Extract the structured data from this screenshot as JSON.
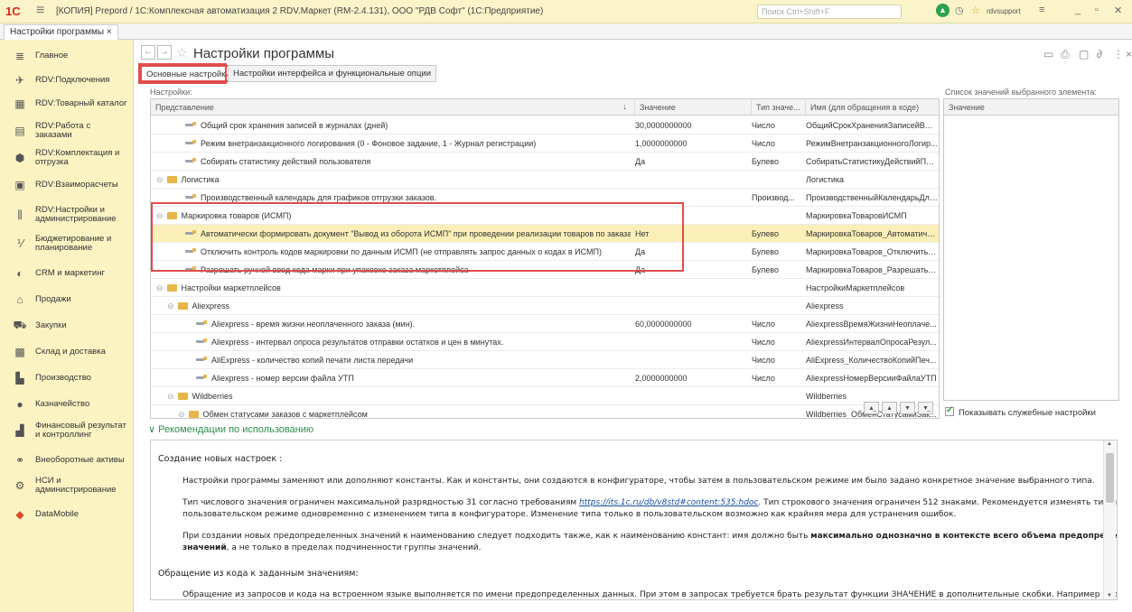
{
  "titlebar": {
    "logo": "1С",
    "title": "[КОПИЯ] Prepord / 1С:Комплексная автоматизация 2 RDV.Маркет (RM-2.4.131), ООО \"РДВ Софт\" (1С:Предприятие)",
    "search_placeholder": "Поиск Ctrl+Shift+F",
    "user": "rdvsupport"
  },
  "tab": {
    "label": "Настройки программы ×"
  },
  "sidebar": {
    "items": [
      {
        "label": "Главное",
        "icon": "menu-icon"
      },
      {
        "label": "RDV:Подключения",
        "icon": "rocket-icon"
      },
      {
        "label": "RDV:Товарный каталог",
        "icon": "grid-icon"
      },
      {
        "label": "RDV:Работа с заказами",
        "icon": "doc-icon"
      },
      {
        "label": "RDV:Комплектация и отгрузка",
        "icon": "box-icon"
      },
      {
        "label": "RDV:Взаиморасчеты",
        "icon": "calc-icon"
      },
      {
        "label": "RDV:Настройки и администрирование",
        "icon": "sliders-icon"
      },
      {
        "label": "Бюджетирование и планирование",
        "icon": "budget-icon"
      },
      {
        "label": "CRM и маркетинг",
        "icon": "crm-icon"
      },
      {
        "label": "Продажи",
        "icon": "sales-icon"
      },
      {
        "label": "Закупки",
        "icon": "cart-icon"
      },
      {
        "label": "Склад и доставка",
        "icon": "warehouse-icon"
      },
      {
        "label": "Производство",
        "icon": "factory-icon"
      },
      {
        "label": "Казначейство",
        "icon": "treasury-icon"
      },
      {
        "label": "Финансовый результат и контроллинг",
        "icon": "chart-icon"
      },
      {
        "label": "Внеоборотные активы",
        "icon": "assets-icon"
      },
      {
        "label": "НСИ и администрирование",
        "icon": "gear-icon"
      },
      {
        "label": "DataMobile",
        "icon": "datamobile-icon"
      }
    ]
  },
  "page": {
    "title": "Настройки программы",
    "tabs": [
      "Основные настройки",
      "Настройки интерфейса и функциональные опции"
    ],
    "settings_label": "Настройки:",
    "list_label": "Список значений выбранного элемента:"
  },
  "grid": {
    "headers": [
      "Представление",
      "Значение",
      "Тип значе...",
      "Имя (для обращения в коде)"
    ],
    "rows": [
      {
        "type": "param",
        "level": 2,
        "name": "Общий срок хранения записей в журналах (дней)",
        "value": "30,0000000000",
        "vtype": "Число",
        "code": "ОбщийСрокХраненияЗаписейВЖ..."
      },
      {
        "type": "param",
        "level": 2,
        "name": "Режим внетранзакционного логирования (0 - Фоновое задание, 1 - Журнал регистрации)",
        "value": "1,0000000000",
        "vtype": "Число",
        "code": "РежимВнетранзакционногоЛогир..."
      },
      {
        "type": "param",
        "level": 2,
        "name": "Собирать статистику действий пользователя",
        "value": "Да",
        "vtype": "Булево",
        "code": "СобиратьСтатистикуДействийПол..."
      },
      {
        "type": "group",
        "level": 1,
        "name": "Логистика",
        "value": "",
        "vtype": "",
        "code": "Логистика"
      },
      {
        "type": "param",
        "level": 2,
        "name": "Производственный календарь для графиков отгрузки заказов.",
        "value": "",
        "vtype": "Производ...",
        "code": "ПроизводственныйКалендарьДля..."
      },
      {
        "type": "group",
        "level": 1,
        "name": "Маркировка товаров (ИСМП)",
        "value": "",
        "vtype": "",
        "code": "МаркировкаТоваровИСМП"
      },
      {
        "type": "param",
        "level": 2,
        "name": "Автоматически формировать документ \"Вывод из оборота ИСМП\" при проведении реализации товаров по заказам марке...",
        "value": "Нет",
        "vtype": "Булево",
        "code": "МаркировкаТоваров_Автоматиче...",
        "selected": true
      },
      {
        "type": "param",
        "level": 2,
        "name": "Отключить контроль кодов маркировки по данным ИСМП (не отправлять запрос данных о кодах в ИСМП)",
        "value": "Да",
        "vtype": "Булево",
        "code": "МаркировкаТоваров_ОтключитьК..."
      },
      {
        "type": "param",
        "level": 2,
        "name": "Разрешать ручной ввод кода марки при упаковке заказа маркетплейса",
        "value": "Да",
        "vtype": "Булево",
        "code": "МаркировкаТоваров_РазрешатьР..."
      },
      {
        "type": "group",
        "level": 1,
        "name": "Настройки маркетплейсов",
        "value": "",
        "vtype": "",
        "code": "НастройкиМаркетплейсов"
      },
      {
        "type": "group",
        "level": 2,
        "name": "Aliexpress",
        "value": "",
        "vtype": "",
        "code": "Aliexpress"
      },
      {
        "type": "param",
        "level": 3,
        "name": "Aliexpress  - время жизни неоплаченного заказа (мин).",
        "value": "60,0000000000",
        "vtype": "Число",
        "code": "AliexpressВремяЖизниНеоплаче..."
      },
      {
        "type": "param",
        "level": 3,
        "name": "Aliexpress - интервал опроса результатов отправки остатков и цен в минутах.",
        "value": "",
        "vtype": "Число",
        "code": "AliexpressИнтервалОпросаРезул..."
      },
      {
        "type": "param",
        "level": 3,
        "name": "AliExpress - количество копий печати листа передачи",
        "value": "",
        "vtype": "Число",
        "code": "AliExpress_КоличествоКопийПеч..."
      },
      {
        "type": "param",
        "level": 3,
        "name": "Aliexpress - номер версии файла УТП",
        "value": "2,0000000000",
        "vtype": "Число",
        "code": "AliexpressНомерВерсииФайлаУТП"
      },
      {
        "type": "group",
        "level": 2,
        "name": "Wildberries",
        "value": "",
        "vtype": "",
        "code": "Wildberries"
      },
      {
        "type": "group",
        "level": 3,
        "name": "Обмен статусами заказов с маркетплейсом",
        "value": "",
        "vtype": "",
        "code": "Wildberries_ОбменСтатусамиЗак..."
      }
    ]
  },
  "side_panel": {
    "header": "Значение"
  },
  "checkbox": {
    "label": "Показывать служебные настройки",
    "checked": true
  },
  "recommendations": {
    "title": "Рекомендации по использованию",
    "heading1": "Создание новых настроек :",
    "p1": "Настройки программы заменяют или дополняют константы. Как и константы, они создаются в конфигураторе, чтобы затем в пользовательском режиме им было задано конкретное значение выбранного типа.",
    "p2a": "Тип числового значения ограничен максимальной разрядностью 31 согласно требованиям ",
    "p2link": "https://its.1c.ru/db/v8std#content:535:hdoc",
    "p2b": ". Тип строкового значения ограничен 512 знаками.  Рекомендуется изменять тип значения в",
    "p2c": "пользовательском режиме одновременно с изменением типа в конфигураторе. Изменение типа только в пользовательском возможно как крайняя мера для устранения ошибок.",
    "p3a": "При создании новых предопределенных значений к наименованию следует подходить также, как к наименованию констант: имя должно быть ",
    "p3bold": "максимально однозначно в контексте всего объема предопределенных",
    "p3bold2": "значений",
    "p3b": ", а не только в пределах подчиненности группы значений.",
    "heading2": "Обращение из кода к заданным значениям:",
    "p4": "Обращение из запросов и кода на встроенном языке выполняется по имени предопределенных данных. При этом в запросах требуется брать результат функции ЗНАЧЕНИЕ в дополнительные скобки. Например в условии"
  }
}
